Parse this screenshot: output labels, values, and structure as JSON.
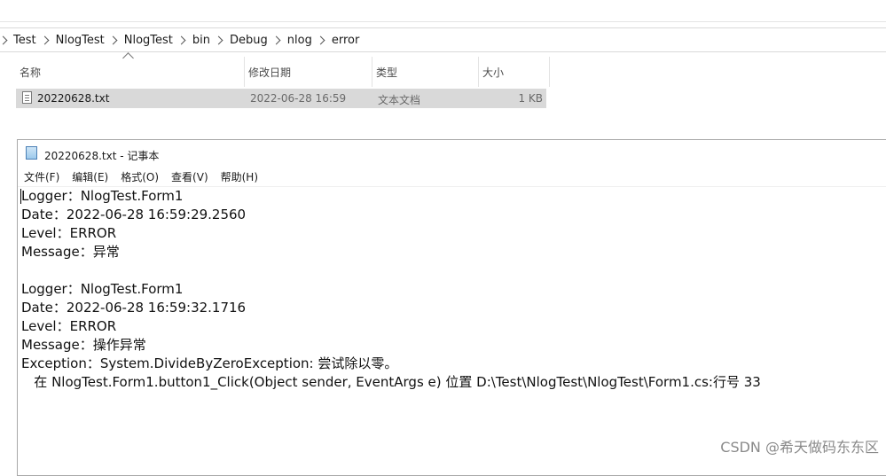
{
  "breadcrumb": [
    "Test",
    "NlogTest",
    "NlogTest",
    "bin",
    "Debug",
    "nlog",
    "error"
  ],
  "columns": {
    "name": "名称",
    "modified": "修改日期",
    "type": "类型",
    "size": "大小"
  },
  "file": {
    "name": "20220628.txt",
    "modified": "2022-06-28 16:59",
    "type": "文本文档",
    "size": "1 KB"
  },
  "notepad": {
    "title": "20220628.txt - 记事本",
    "menu": [
      "文件(F)",
      "编辑(E)",
      "格式(O)",
      "查看(V)",
      "帮助(H)"
    ],
    "lines": [
      "Logger：NlogTest.Form1",
      "Date：2022-06-28 16:59:29.2560",
      "Level：ERROR",
      "Message：异常",
      "",
      "Logger：NlogTest.Form1",
      "Date：2022-06-28 16:59:32.1716",
      "Level：ERROR",
      "Message：操作异常",
      "Exception：System.DivideByZeroException: 尝试除以零。",
      "   在 NlogTest.Form1.button1_Click(Object sender, EventArgs e) 位置 D:\\Test\\NlogTest\\NlogTest\\Form1.cs:行号 33"
    ]
  },
  "watermark": "CSDN @希天做码东东区"
}
